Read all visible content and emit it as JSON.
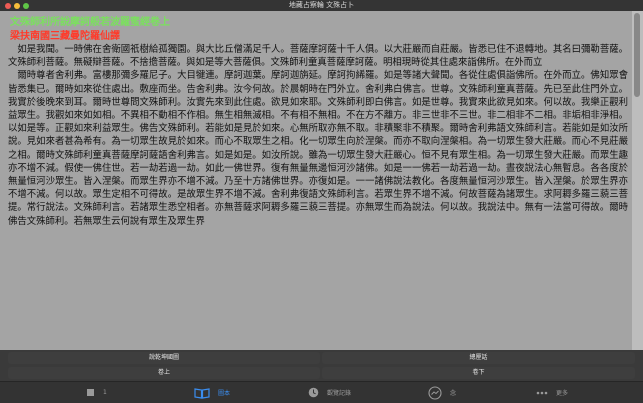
{
  "window": {
    "title": "地藏占察輪 文殊占卜"
  },
  "header": {
    "line1": "文殊師利所說摩訶般若波羅蜜經卷上",
    "line2": "梁扶南國三藏曼陀羅仙譯"
  },
  "body_text": "　如是我聞。一時佛在舍衛國祇樹給孤獨園。與大比丘僧滿足千人。菩薩摩訶薩十千人俱。以大莊嚴而自莊嚴。皆悉已住不退轉地。其名曰彌勒菩薩。文殊師利菩薩。無礙辯菩薩。不捨擔菩薩。與如是等大菩薩俱。文殊師利童真菩薩摩訶薩。明相現時從其住處來詣佛所。在外而立\n　爾時尊者舍利弗。富樓那彌多羅尼子。大目犍連。摩訶迦葉。摩訶迦旃延。摩訶拘絺羅。如是等諸大聲聞。各從住處俱詣佛所。在外而立。佛知眾會皆悉集已。爾時如來從住處出。敷座而坐。告舍利弗。汝今何故。於晨朝時在門外立。舍利弗白佛言。世尊。文殊師利童真菩薩。先已至此住門外立。我實於後晚來到耳。爾時世尊問文殊師利。汝實先來到此住處。欲見如來耶。文殊師利即白佛言。如是世尊。我實來此欲見如來。何以故。我樂正觀利益眾生。我觀如來如如相。不異相不動相不作相。無生相無滅相。不有相不無相。不在方不離方。非三世非不三世。非二相非不二相。非垢相非淨相。以如是等。正觀如來利益眾生。佛告文殊師利。若能如是見於如來。心無所取亦無不取。非積聚非不積聚。爾時舍利弗語文殊師利言。若能如是如汝所說。見如來者甚為希有。為一切眾生故見於如來。而心不取眾生之相。化一切眾生向於涅槃。而亦不取向涅槃相。為一切眾生發大莊嚴。而心不見莊嚴之相。爾時文殊師利童真菩薩摩訶薩語舍利弗言。如是如是。如汝所說。雖為一切眾生發大莊嚴心。恒不見有眾生相。為一切眾生發大莊嚴。而眾生趣亦不增不減。假使一佛住世。若一劫若過一劫。如此一佛世界。復有無量無邊恒河沙諸佛。如是一一佛若一劫若過一劫。晝夜說法心無暫息。各各度於無量恒河沙眾生。皆入涅槃。而眾生界亦不增不減。乃至十方諸佛世界。亦復如是。一一諸佛說法教化。各度無量恒河沙眾生。皆入涅槃。於眾生界亦不增不減。何以故。眾生定相不可得故。是故眾生界不增不減。舍利弗復語文殊師利言。若眾生界不增不減。何故菩薩為諸眾生。求阿耨多羅三藐三菩提。常行說法。文殊師利言。若諸眾生悉空相者。亦無菩薩求阿耨多羅三藐三菩提。亦無眾生而為說法。何以故。我說法中。無有一法當可得故。爾時佛告文殊師利。若無眾生云何說有眾生及眾生界",
  "buttons": {
    "row1_left": "說乾坤國圖",
    "row1_right": "總厘話",
    "row2_left": "卷上",
    "row2_right": "卷下"
  },
  "tabs": [
    {
      "label": "1",
      "icon": "bookmark-icon"
    },
    {
      "label": "圖本",
      "icon": "book-icon",
      "active": true
    },
    {
      "label": "觀覽記錄",
      "icon": "history-icon"
    },
    {
      "label": "念",
      "icon": "stats-icon"
    },
    {
      "label": "更多",
      "icon": "more-icon"
    }
  ],
  "colors": {
    "accent": "#3b8ef0",
    "heading1": "#7be05e",
    "heading2": "#ff3a2a",
    "content_bg": "#a4a4a4"
  }
}
